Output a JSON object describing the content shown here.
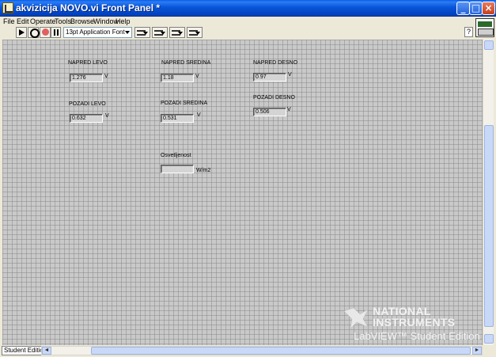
{
  "window": {
    "title": "akvizicija NOVO.vi Front Panel *",
    "minimize": "_",
    "maximize": "□",
    "close": "×"
  },
  "menu": {
    "items": [
      {
        "label": "File"
      },
      {
        "label": "Edit"
      },
      {
        "label": "Operate"
      },
      {
        "label": "Tools"
      },
      {
        "label": "Browse"
      },
      {
        "label": "Window"
      },
      {
        "label": "Help"
      }
    ]
  },
  "toolbar": {
    "font": "13pt Application Font",
    "help": "?"
  },
  "indicators": [
    {
      "label": "NAPRED LEVO",
      "value": "1.276",
      "unit": "V"
    },
    {
      "label": "NAPRED SREDINA",
      "value": "1.18",
      "unit": "V"
    },
    {
      "label": "NAPRED DESNO",
      "value": "0.97",
      "unit": "V"
    },
    {
      "label": "POZADI LEVO",
      "value": "0.632",
      "unit": "V"
    },
    {
      "label": "POZADI SREDINA",
      "value": "0.531",
      "unit": "V"
    },
    {
      "label": "POZADI DESNO",
      "value": "0.506",
      "unit": "V"
    },
    {
      "label": "Osvetljenost",
      "value": "",
      "unit": "W/m2"
    }
  ],
  "watermark": {
    "line1": "NATIONAL",
    "line2": "INSTRUMENTS",
    "line3": "LabVIEW™ Student Edition"
  },
  "status": {
    "edition": "Student Edition",
    "scroll_left": "◄",
    "scroll_right": "►"
  },
  "colors": {
    "titlebar": "#0a56d8",
    "panel": "#c9c9c9",
    "indicator": "#d4d4d4"
  }
}
